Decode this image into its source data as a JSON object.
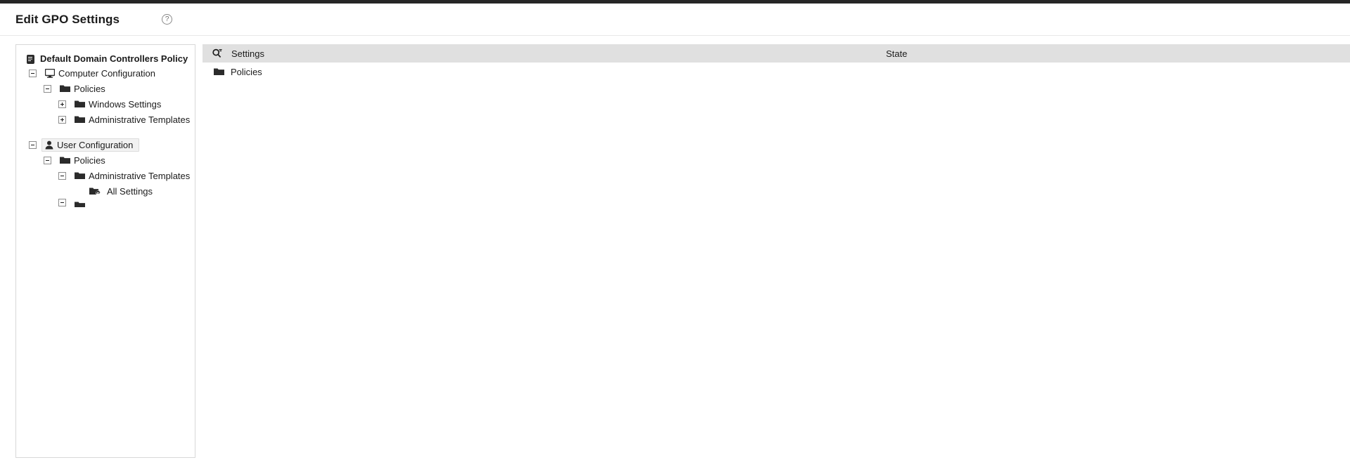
{
  "header": {
    "title": "Edit GPO Settings",
    "help_icon": "question-mark-circle-icon",
    "help_label": "?"
  },
  "tree": {
    "root": {
      "label": "Default Domain Controllers Policy",
      "icon": "gpo-scroll-icon"
    },
    "nodes": [
      {
        "label": "Computer Configuration",
        "icon": "monitor-icon",
        "expander": "minus",
        "indent": 1,
        "selected": false
      },
      {
        "label": "Policies",
        "icon": "folder-icon",
        "expander": "minus",
        "indent": 2,
        "selected": false
      },
      {
        "label": "Windows Settings",
        "icon": "folder-icon",
        "expander": "plus",
        "indent": 3,
        "selected": false
      },
      {
        "label": "Administrative Templates",
        "icon": "folder-icon",
        "expander": "plus",
        "indent": 3,
        "selected": false
      },
      {
        "label": "User Configuration",
        "icon": "user-icon",
        "expander": "minus",
        "indent": 1,
        "selected": true
      },
      {
        "label": "Policies",
        "icon": "folder-icon",
        "expander": "minus",
        "indent": 2,
        "selected": false
      },
      {
        "label": "Administrative Templates",
        "icon": "folder-icon",
        "expander": "minus",
        "indent": 3,
        "selected": false
      },
      {
        "label": "All Settings",
        "icon": "folder-gear-icon",
        "expander": "none",
        "indent": 4,
        "selected": false
      }
    ]
  },
  "settings_panel": {
    "columns": {
      "settings": {
        "label": "Settings",
        "icon": "search-filter-icon"
      },
      "state": {
        "label": "State"
      }
    },
    "rows": [
      {
        "label": "Policies",
        "icon": "folder-icon",
        "state": ""
      }
    ]
  }
}
